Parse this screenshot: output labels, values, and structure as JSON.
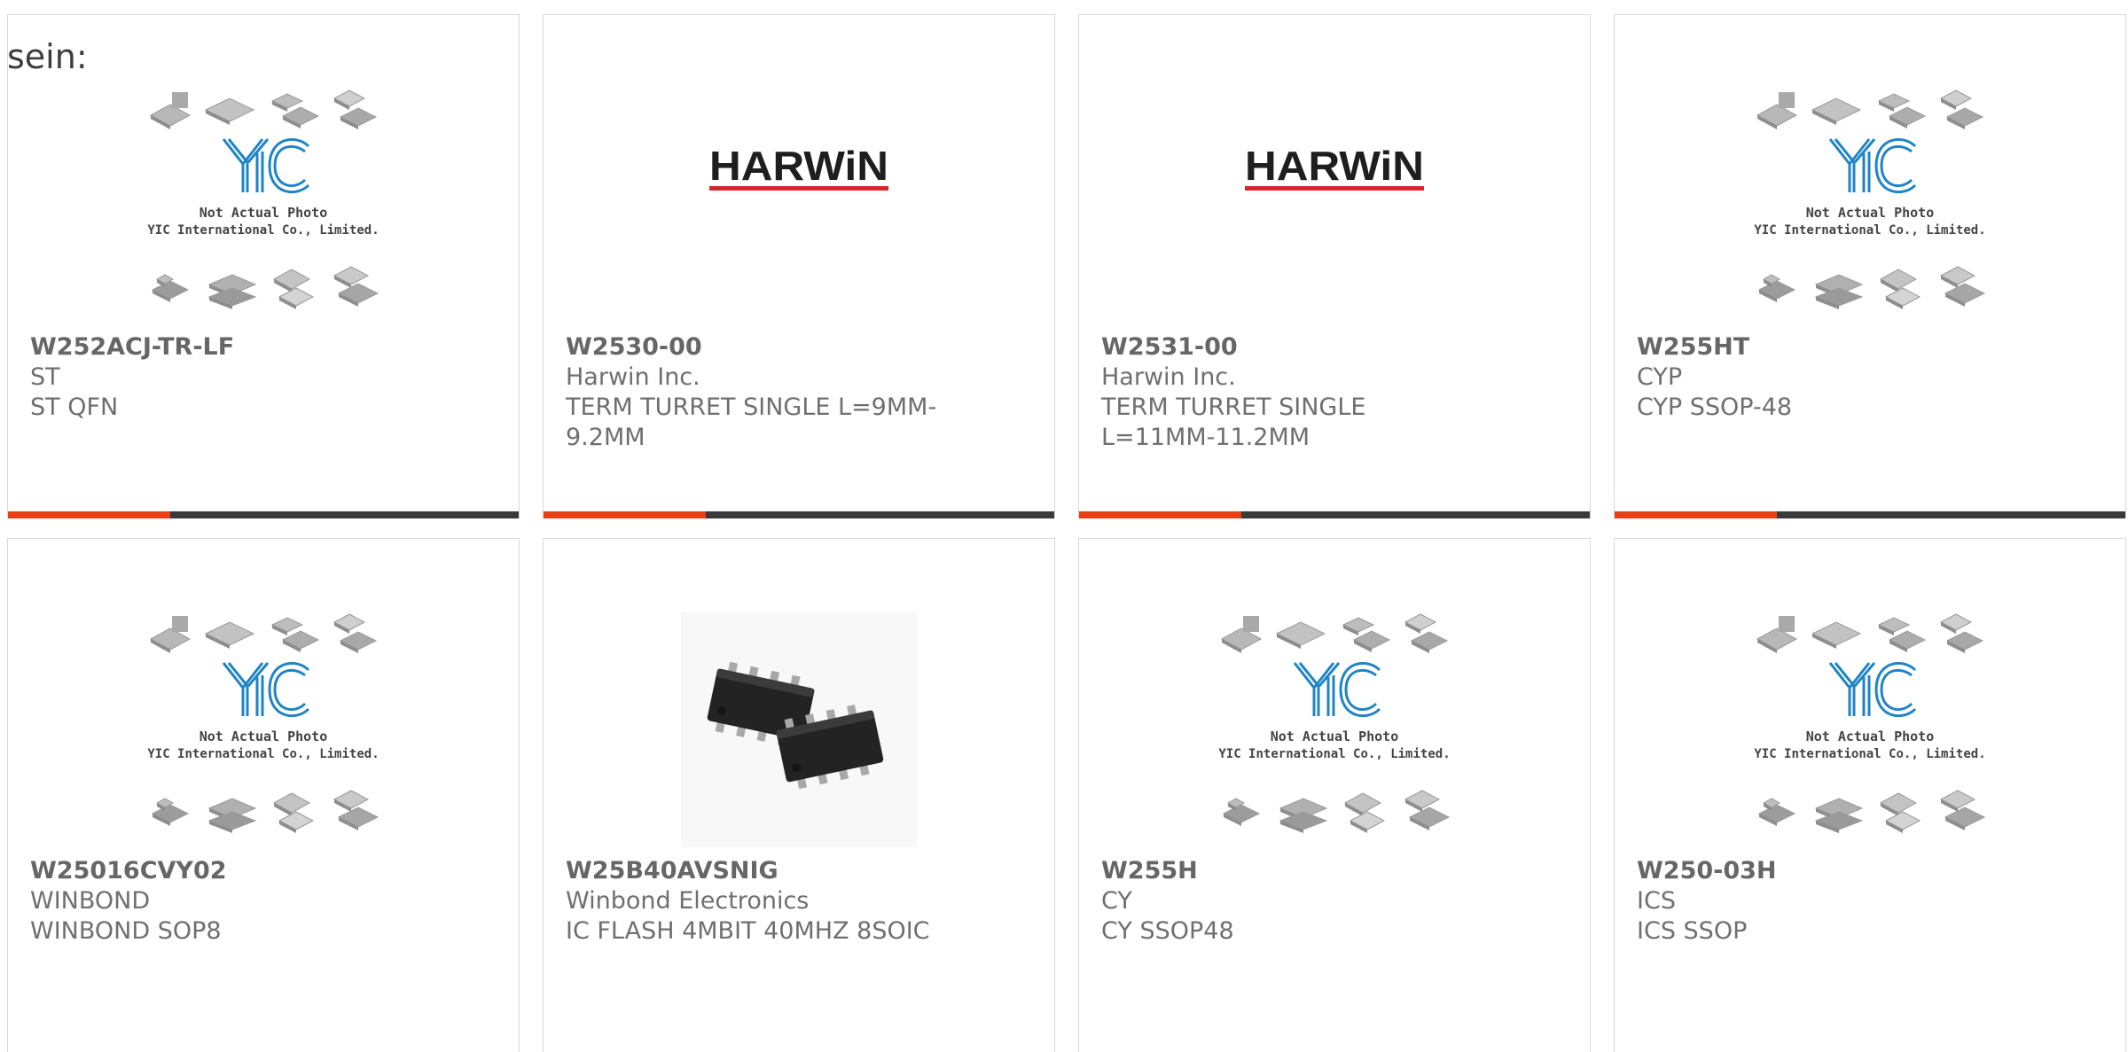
{
  "intro": "sein:",
  "colors": {
    "accent": "#e84118",
    "bar": "#3a3a3a",
    "yic_blue": "#1f84c6",
    "harwin_red": "#d7262b"
  },
  "products": [
    {
      "part": "W252ACJ-TR-LF",
      "maker": "ST",
      "desc": "ST QFN",
      "image": "placeholder",
      "photo_note": "Not Actual Photo",
      "photo_company": "YIC International Co., Limited."
    },
    {
      "part": "W2530-00",
      "maker": "Harwin Inc.",
      "desc": "TERM TURRET SINGLE L=9MM-9.2MM",
      "image": "harwin-logo",
      "logo_text": "HARWiN"
    },
    {
      "part": "W2531-00",
      "maker": "Harwin Inc.",
      "desc": "TERM TURRET SINGLE L=11MM-11.2MM",
      "image": "harwin-logo",
      "logo_text": "HARWiN"
    },
    {
      "part": "W255HT",
      "maker": "CYP",
      "desc": "CYP SSOP-48",
      "image": "placeholder",
      "photo_note": "Not Actual Photo",
      "photo_company": "YIC International Co., Limited."
    },
    {
      "part": "W25016CVY02",
      "maker": "WINBOND",
      "desc": "WINBOND SOP8",
      "image": "placeholder",
      "photo_note": "Not Actual Photo",
      "photo_company": "YIC International Co., Limited."
    },
    {
      "part": "W25B40AVSNIG",
      "maker": "Winbond Electronics",
      "desc": "IC FLASH 4MBIT 40MHZ 8SOIC",
      "image": "soic8-photo"
    },
    {
      "part": "W255H",
      "maker": "CY",
      "desc": "CY SSOP48",
      "image": "placeholder",
      "photo_note": "Not Actual Photo",
      "photo_company": "YIC International Co., Limited."
    },
    {
      "part": "W250-03H",
      "maker": "ICS",
      "desc": "ICS SSOP",
      "image": "placeholder",
      "photo_note": "Not Actual Photo",
      "photo_company": "YIC International Co., Limited."
    }
  ]
}
